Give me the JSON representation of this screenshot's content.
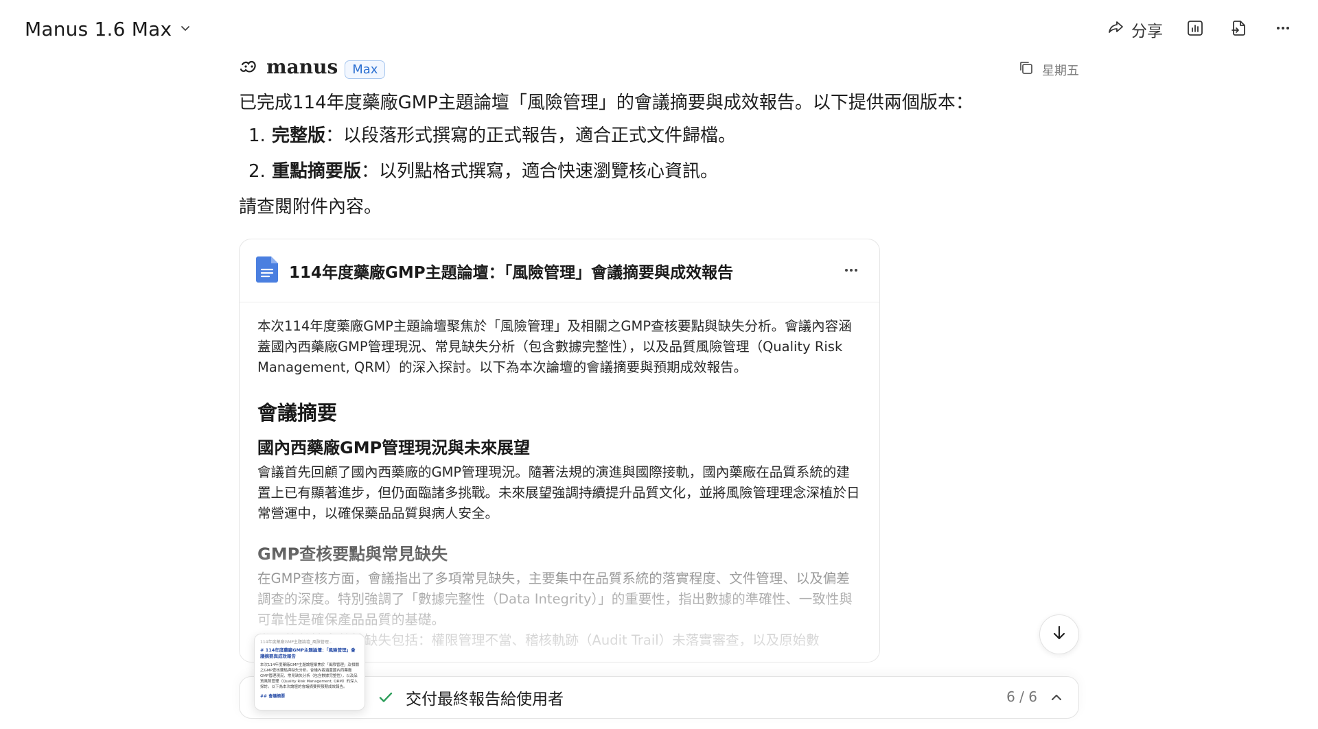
{
  "topbar": {
    "model_name": "Manus 1.6 Max",
    "share_label": "分享"
  },
  "message": {
    "brand_name": "manus",
    "badge": "Max",
    "day": "星期五",
    "intro": "已完成114年度藥廠GMP主題論壇「風險管理」的會議摘要與成效報告。以下提供兩個版本：",
    "list": [
      {
        "num": "1.",
        "bold": "完整版",
        "rest": "：以段落形式撰寫的正式報告，適合正式文件歸檔。"
      },
      {
        "num": "2.",
        "bold": "重點摘要版",
        "rest": "：以列點格式撰寫，適合快速瀏覽核心資訊。"
      }
    ],
    "outro": "請查閱附件內容。"
  },
  "doc": {
    "title": "114年度藥廠GMP主題論壇：「風險管理」會議摘要與成效報告",
    "intro_para": "本次114年度藥廠GMP主題論壇聚焦於「風險管理」及相關之GMP查核要點與缺失分析。會議內容涵蓋國內西藥廠GMP管理現況、常見缺失分析（包含數據完整性），以及品質風險管理（Quality Risk Management, QRM）的深入探討。以下為本次論壇的會議摘要與預期成效報告。",
    "h2": "會議摘要",
    "section1_title": "國內西藥廠GMP管理現況與未來展望",
    "section1_para": "會議首先回顧了國內西藥廠的GMP管理現況。隨著法規的演進與國際接軌，國內藥廠在品質系統的建置上已有顯著進步，但仍面臨諸多挑戰。未來展望強調持續提升品質文化，並將風險管理理念深植於日常營運中，以確保藥品品質與病人安全。",
    "section2_title": "GMP查核要點與常見缺失",
    "section2_para": "在GMP查核方面，會議指出了多項常見缺失，主要集中在品質系統的落實程度、文件管理、以及偏差調查的深度。特別強調了「數據完整性（Data Integrity）」的重要性，指出數據的準確性、一致性與可靠性是確保產品品質的基礎。",
    "section2_more": "常見的數據完整性缺失包括：權限管理不當、稽核軌跡（Audit Trail）未落實審查，以及原始數"
  },
  "task": {
    "label": "交付最終報告給使用者",
    "count": "6 / 6"
  },
  "thumbnail": {
    "head": "114年度藥廠GMP主題論壇_風險管理...",
    "title": "# 114年度藥廠GMP主題論壇：「風險管理」會議摘要與成效報告",
    "body": "本次114年度藥廠GMP主題論壇聚焦於「風險管理」及相關之GMP查核要點與缺失分析。會議內容涵蓋國內西藥廠GMP管理現況、常見缺失分析（包含數據完整性），以及品質風險管理（Quality Risk Management, QRM）的深入探討。以下為本次論壇的會議摘要與預期成效報告。",
    "foot": "## 會議摘要"
  },
  "colors": {
    "accent_blue": "#2a6fd1",
    "doc_icon_blue": "#4a7fe0",
    "check_green": "#2e9e5b"
  },
  "icons": {
    "model_chevron": "chevron-down-icon",
    "share": "share-arrow-icon",
    "slides": "chart-icon",
    "export": "document-export-icon",
    "more": "more-horizontal-icon",
    "scroll": "arrow-down-icon",
    "task_check": "check-icon",
    "task_toggle": "chevron-up-icon"
  }
}
